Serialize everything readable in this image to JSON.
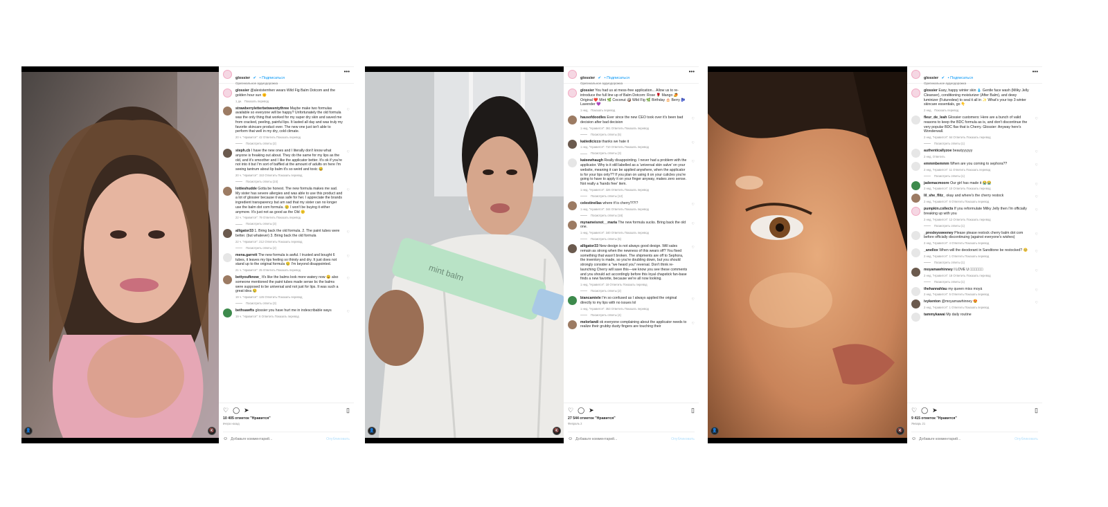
{
  "posts": [
    {
      "header": {
        "username": "glossier",
        "verified": "✔",
        "follow": "• Подписаться",
        "audio": "Оригинальное аудиодорожка",
        "more": "•••"
      },
      "caption": {
        "user": "glossier",
        "text": "@alexistemhen wears Wild Fig Balm Dotcom and the golden hour sun 🌞",
        "time": "1 дн.",
        "translate": "Показать перевод"
      },
      "comments": [
        {
          "user": "strawberryletterbetweentythree",
          "text": "Maybe make two formulas available so everyone will be happy? Unfortunately the old formula was the only thing that worked for my super dry skin and saved me from cracked, peeling, painful lips. It lasted all day and was truly my favorite skincare product ever. The new one just isn't able to perform that well in my dry, cold climate.",
          "meta": "20 ч.  \"Нравится\": 42  Ответить  Показать перевод",
          "replies": "Посмотреть ответы (2)"
        },
        {
          "user": "steph.cb",
          "text": "I have the new ones and I literally don't know what anyone is freaking out about. They do the same for my lips as the old, and it's smoother and I like the applicator better. It's ok if you're not into it but I'm sort of baffled at the amount of adults on here I'm seeing tantrum about lip balm it's so weird and toxic 😂",
          "meta": "20 ч.  \"Нравится\": 153  Ответить  Показать перевод",
          "replies": "Посмотреть ответы (24)"
        },
        {
          "user": "lottieshudde",
          "text": "Gotta be honest. The new formula makes me sad. My sister has severe allergies and was able to use this product and a lot of glossier because it was safe for her. I appreciate the brands ingredient transparency but am sad that my sister can no longer use the balm dot com formula. 😢 I won't be buying it either anymore. It's just not as good as the Old 🙁",
          "meta": "22 ч.  \"Нравится\": 79  Ответить  Показать перевод",
          "replies": "Посмотреть ответы (3)"
        },
        {
          "user": "alligator33",
          "text": "1. Bring back the old formula. 2. The paint tubes were better. (but whatever) 3. Bring back the old formula",
          "meta": "22 ч.  \"Нравится\": 212  Ответить  Показать перевод",
          "replies": "Посмотреть ответы (2)"
        },
        {
          "user": "mena.garrett",
          "text": "The new formula is awful. I trusted and bought 6 tubes, it leaves my lips feeling so thirsty and dry. It just does not stand up to the original formula 😢 I'm beyond disappointed.",
          "meta": "21 ч.  \"Нравится\": 25  Ответить  Показать перевод",
          "replies": ""
        },
        {
          "user": "bettyoufknow_",
          "text": "It's like the balms look more watery now 😩 also someone mentioned the paint tubes made sense bc the balms were supposed to be universal and not just for lips. It was such a great idea 😢",
          "meta": "19 ч.  \"Нравится\": 126  Ответить  Показать перевод",
          "replies": "Посмотреть ответы (3)"
        },
        {
          "user": "bethsawfts",
          "text": "glossier you have hurt me in indescribable ways",
          "meta": "19 ч.  \"Нравится\": 6  Ответить  Показать перевод",
          "replies": ""
        }
      ],
      "likes": "10 405 отметок \"Нравится\"",
      "date": "вчера назад",
      "add_placeholder": "Добавьте комментарий...",
      "publish": "Опубликовать"
    },
    {
      "header": {
        "username": "glossier",
        "verified": "✔",
        "follow": "• Подписаться",
        "audio": "Оригинальное аудиодорожка",
        "more": "•••"
      },
      "caption": {
        "user": "glossier",
        "text": "You had us at mess-free application... Allow us to re-introduce the full line up of Balm Dotcom: Rose 🌹 Mango 🥭 Original ❤️ Mint 🌿 Coconut 🥥 Wild Fig 🌿 Birthday 🎂 Berry 🫐 Lavender 💜",
        "time": "1 нед.",
        "translate": "Показать перевод"
      },
      "comments": [
        {
          "user": "hausofdoodles",
          "text": "Ever since the new CEO took over it's been bad decision after bad decision",
          "meta": "1 нед.  \"Нравится\": 361  Ответить  Показать перевод",
          "replies": "Посмотреть ответы (5)"
        },
        {
          "user": "katiedicicco",
          "text": "thanks we hate it",
          "meta": "1 нед.  \"Нравится\": 710  Ответить  Показать перевод",
          "replies": "Посмотреть ответы (3)"
        },
        {
          "user": "kateewhaugh",
          "text": "Really disappointing. I never had a problem with the applicator. Why is it still labelled as a 'universal skin salve' on your website, meaning it can be applied anywhere, when the applicator is for your lips only?? If you plan on using it on your cuticles you're going to have to apply it on your finger anyway, makes zero sense. Not really a 'hands free' item.",
          "meta": "1 нед.  \"Нравится\": 326  Ответить  Показать перевод",
          "replies": "Посмотреть ответы (12)"
        },
        {
          "user": "celestinellas",
          "text": "where tf is cherry?!?!?",
          "meta": "1 нед.  \"Нравится\": 344  Ответить  Показать перевод",
          "replies": "Посмотреть ответы (16)"
        },
        {
          "user": "mynameisnot__maria",
          "text": "The new formula sucks. Bring back the old one.",
          "meta": "1 нед.  \"Нравится\": 340  Ответить  Показать перевод",
          "replies": "Посмотреть ответы (5)"
        },
        {
          "user": "alligator33",
          "text": "New design is not always good design. Will sales remain as strong when the newness of this wears off? You fixed something that wasn't broken. The shipments are off to Sephora, the inventory is made, so you're doubling down, but you should strongly consider a \"we heard you\" reversal. Don't think re-launching Cherry will save this—we know you see these comments and you should act accordingly before this loyal chapstick fan-base finds a new favorite, because we're all now looking.",
          "meta": "1 нед.  \"Нравится\": 18  Ответить  Показать перевод",
          "replies": "Посмотреть ответы (2)"
        },
        {
          "user": "biancamiele",
          "text": "I'm so confused as I always applied the original directly to my lips with no issues lol",
          "meta": "1 нед.  \"Нравится\": 353  Ответить  Показать перевод",
          "replies": "Посмотреть ответы (4)"
        },
        {
          "user": "melorlandi",
          "text": "ok everyone complaining about the applicator needs to realize their grubby dusty fingers are touching their",
          "meta": "",
          "replies": ""
        }
      ],
      "likes": "27 544 отметок \"Нравится\"",
      "date": "Февраль 2",
      "add_placeholder": "Добавьте комментарий...",
      "publish": "Опубликовать"
    },
    {
      "header": {
        "username": "glossier",
        "verified": "✔",
        "follow": "• Подписаться",
        "audio": "Оригинальное аудиодорожка",
        "more": "•••"
      },
      "caption": {
        "user": "glossier",
        "text": "Easy, happy winter skin 💧 Gentle face wash (Milky Jelly Cleanser), conditioning moisturizer (After Balm), and dewy luminizer (Futuredew) to seal it all in ✨ What's your top 3 winter skincare essentials, go 👇",
        "time": "2 нед.",
        "translate": "Показать перевод"
      },
      "comments": [
        {
          "user": "fleur_de_leah",
          "text": "Glossier customers: Here are a bunch of valid reasons to keep the BDC formula as is, and don't discontinue the very popular BDC flav that is Cherry. Glossier: Anyway here's Wonderwall.",
          "meta": "2 нед.  \"Нравится\": 64  Ответить  Показать перевод",
          "replies": "Посмотреть ответы (1)"
        },
        {
          "user": "authenticallyzoe",
          "text": "beautyyyyyy",
          "meta": "2 нед.  Ответить",
          "replies": ""
        },
        {
          "user": "emmmbemmm",
          "text": "When are you coming to sephora??",
          "meta": "2 нед.  \"Нравится\": 11  Ответить  Показать перевод",
          "replies": "Посмотреть ответы (1)"
        },
        {
          "user": "jademacmoore",
          "text": "Our girl has made it 😭😭",
          "meta": "2 нед.  \"Нравится\": 10  Ответить  Показать перевод",
          "replies": ""
        },
        {
          "user": "lil_she_flitz_",
          "text": "okay and where's the cherry restock",
          "meta": "2 нед.  \"Нравится\": 6  Ответить  Показать перевод",
          "replies": ""
        },
        {
          "user": "pumpkin.collects",
          "text": "If you reformulate Milky Jelly then I'm officially breaking up with you",
          "meta": "2 нед.  \"Нравится\": 12  Ответить  Показать перевод",
          "replies": "Посмотреть ответы (1)"
        },
        {
          "user": "_presleysweeney",
          "text": "Please please restock cherry balm dot com before officially discontinuing (against everyone's wishes)",
          "meta": "2 нед.  \"Нравится\": 4  Ответить  Показать перевод",
          "replies": ""
        },
        {
          "user": "_anellox",
          "text": "When will the deodorant in Sanditone be restocked? 🥺",
          "meta": "2 нед.  \"Нравится\": 1  Ответить  Показать перевод",
          "replies": "Посмотреть ответы (1)"
        },
        {
          "user": "moyamawhinney",
          "text": "I LOVE U □□□□□□",
          "meta": "2 нед.  \"Нравится\": 18  Ответить  Показать перевод",
          "replies": "Посмотреть ответы (1)"
        },
        {
          "user": "thehannahlau",
          "text": "my queen miss moyá",
          "meta": "2 нед.  \"Нравится\": 5  Ответить  Показать перевод",
          "replies": ""
        },
        {
          "user": "ivykenton",
          "text": "@moyamawhinney 😍",
          "meta": "2 нед.  \"Нравится\": 1  Ответить  Показать перевод",
          "replies": ""
        },
        {
          "user": "tammykawai",
          "text": "My daily routine",
          "meta": "",
          "replies": ""
        }
      ],
      "likes": "9 415 отметок \"Нравится\"",
      "date": "Январь 21",
      "add_placeholder": "Добавьте комментарий...",
      "publish": "Опубликовать"
    }
  ],
  "icons": {
    "like": "♡",
    "comment": "◯",
    "share": "➤",
    "save": "▯",
    "smile": "☺",
    "user": "👤",
    "mute": "🔇",
    "heart_small": "♡"
  }
}
